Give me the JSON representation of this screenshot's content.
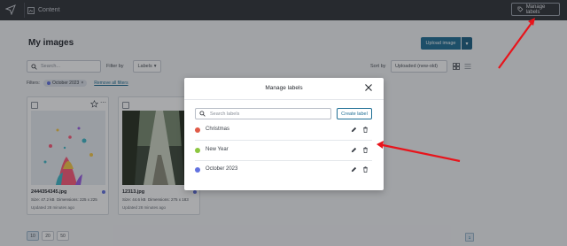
{
  "topbar": {
    "content_label": "Content",
    "manage_labels_label": "Manage labels"
  },
  "page": {
    "title": "My images",
    "upload_label": "Upload image",
    "search_placeholder": "Search...",
    "filter_by_label": "Filter by",
    "labels_button": "Labels",
    "sort_by_label": "Sort by",
    "sort_value": "Uploaded (new-old)",
    "filters_label": "Filters:",
    "filter_chip": "October 2023",
    "remove_filters": "Remove all filters"
  },
  "cards": [
    {
      "name": "2444354345.jpg",
      "size": "Size: 47.2 kB",
      "dimensions": "Dimensions: 225 x 225",
      "updated": "Updated 28 minutes ago",
      "label_color": "#6272e0"
    },
    {
      "name": "12313.jpg",
      "size": "Size: 44.6 kB",
      "dimensions": "Dimensions: 275 x 183",
      "updated": "Updated 28 minutes ago",
      "label_color": "#6272e0"
    }
  ],
  "pagination": {
    "sizes": [
      "10",
      "20",
      "50"
    ],
    "active": "10",
    "current_page": "1"
  },
  "modal": {
    "title": "Manage labels",
    "search_placeholder": "Search labels",
    "create_label": "Create label",
    "labels": [
      {
        "name": "Christmas",
        "color": "#e05a47"
      },
      {
        "name": "New Year",
        "color": "#8cc63f"
      },
      {
        "name": "October 2023",
        "color": "#6272e0"
      }
    ]
  }
}
